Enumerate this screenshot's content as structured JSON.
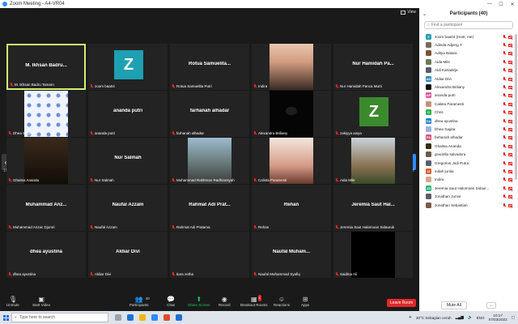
{
  "window": {
    "title": "Zoom Meeting - A4-VR04"
  },
  "view_label": "View",
  "pages": {
    "left": "1/2",
    "right": "1/2"
  },
  "tiles": [
    {
      "center": "M. Ikhsan Badru...",
      "label": "M. Ikhsan Badru Tamam",
      "kind": "name",
      "active": true
    },
    {
      "center": "",
      "label": "zoom baa04",
      "kind": "avatar",
      "letter": "Z",
      "color": "#1e9fb2"
    },
    {
      "center": "Rotua Samuelita...",
      "label": "Rotua Samuelita Putri",
      "kind": "name"
    },
    {
      "center": "",
      "label": "Indira",
      "kind": "photo",
      "photo": "girl"
    },
    {
      "center": "Nur Hamidah Pa...",
      "label": "Nur Hamidah Panca Murti",
      "kind": "name"
    },
    {
      "center": "",
      "label": "Dhea Sagita",
      "kind": "photo",
      "photo": "pattern"
    },
    {
      "center": "ananda putri",
      "label": "ananda putri",
      "kind": "name"
    },
    {
      "center": "farhanah alhadar",
      "label": "farhanah alhadar",
      "kind": "name"
    },
    {
      "center": "",
      "label": "Alexandra Briliany",
      "kind": "photo",
      "photo": "cat"
    },
    {
      "center": "",
      "label": "zakiyya aisya",
      "kind": "avatar",
      "letter": "Z",
      "color": "#3b8a2e"
    },
    {
      "center": "",
      "label": "Ghaitsa Ananda",
      "kind": "photo",
      "photo": "night"
    },
    {
      "center": "Nur Salmah",
      "label": "Nur Salmah",
      "kind": "name"
    },
    {
      "center": "",
      "label": "Muhammad Rakhman Radhiansyah",
      "kind": "photo",
      "photo": "street"
    },
    {
      "center": "",
      "label": "Calista Paramesti",
      "kind": "photo",
      "photo": "girl2"
    },
    {
      "center": "",
      "label": "Aida Mile",
      "kind": "photo",
      "photo": "building"
    },
    {
      "center": "Muhammad Anz...",
      "label": "Muhammad Anzac Djumri",
      "kind": "name"
    },
    {
      "center": "Naufal Azzam",
      "label": "Naufal Azzam",
      "kind": "name"
    },
    {
      "center": "Rahmat Adi Prat...",
      "label": "Rahmat Adi Pratama",
      "kind": "name"
    },
    {
      "center": "Rehan",
      "label": "Rehan",
      "kind": "name"
    },
    {
      "center": "Jeremia Saut Hal...",
      "label": "Jeremia Saut Halomoan Sidauruk",
      "kind": "name"
    },
    {
      "center": "dhea ayustina",
      "label": "dhea ayustina",
      "kind": "name"
    },
    {
      "center": "Aldiar Divi",
      "label": "Aldiar Divi",
      "kind": "name"
    },
    {
      "center": "",
      "label": "tiara zetha",
      "kind": "name"
    },
    {
      "center": "Naufal Muham...",
      "label": "Naufal Muhammad Syafiq",
      "kind": "name"
    },
    {
      "center": "",
      "label": "Saidina Ali",
      "kind": "photo",
      "photo": "black"
    }
  ],
  "toolbar": {
    "unmute": "Unmute",
    "start_video": "Start Video",
    "participants": "Participants",
    "participants_count": "40",
    "chat": "Chat",
    "share_screen": "Share Screen",
    "record": "Record",
    "breakout": "Breakout Rooms",
    "breakout_badge": "1",
    "reactions": "Reactions",
    "apps": "Apps",
    "leave": "Leave Room"
  },
  "panel": {
    "title": "Participants (40)",
    "search_placeholder": "Find a participant",
    "mute_all": "Mute All",
    "more": "...",
    "participants": [
      {
        "name": "zoom baa04 (Host, me)",
        "initial": "Z",
        "color": "#1e9fb2"
      },
      {
        "name": "Adinda Adjeng T",
        "initial": "",
        "color": "#7a6a5a"
      },
      {
        "name": "Aditya Batara",
        "initial": "",
        "color": "#7d4e3a"
      },
      {
        "name": "Aida Mile",
        "initial": "",
        "color": "#6b7a55"
      },
      {
        "name": "Aldi Kartadirja",
        "initial": "",
        "color": "#555c66"
      },
      {
        "name": "Aldiar Divi",
        "initial": "AD",
        "color": "#2a88b8"
      },
      {
        "name": "Alexandra Briliany",
        "initial": "",
        "color": "#111111"
      },
      {
        "name": "ananda putri",
        "initial": "AP",
        "color": "#e0559c"
      },
      {
        "name": "Calista Paramesti",
        "initial": "",
        "color": "#c98f7a"
      },
      {
        "name": "Chris",
        "initial": "C",
        "color": "#2ab24b"
      },
      {
        "name": "dhea ayustina",
        "initial": "DA",
        "color": "#1e7fd0"
      },
      {
        "name": "Dhea Sagita",
        "initial": "",
        "color": "#9bb1e6"
      },
      {
        "name": "farhanah alhadar",
        "initial": "FA",
        "color": "#d2527a"
      },
      {
        "name": "Ghaitsa Ananda",
        "initial": "",
        "color": "#3a2a1a"
      },
      {
        "name": "graciella salvadora",
        "initial": "",
        "color": "#6c5a4a"
      },
      {
        "name": "Gregorius Jodi Putra",
        "initial": "",
        "color": "#556070"
      },
      {
        "name": "indah junita",
        "initial": "IJ",
        "color": "#e05a2a"
      },
      {
        "name": "Indira",
        "initial": "",
        "color": "#d7a889"
      },
      {
        "name": "Jeremia Saut Halomoan Sidaur...",
        "initial": "JS",
        "color": "#2ab27a"
      },
      {
        "name": "Jonathan Junior",
        "initial": "",
        "color": "#5d5a6a"
      },
      {
        "name": "Jonathan Sebastian",
        "initial": "",
        "color": "#7a5a4a"
      }
    ]
  },
  "taskbar": {
    "search_placeholder": "Type here to search",
    "weather": "30°C  Sebagian cerah",
    "language": "ENG",
    "time": "10:17",
    "date": "07/03/2022"
  }
}
